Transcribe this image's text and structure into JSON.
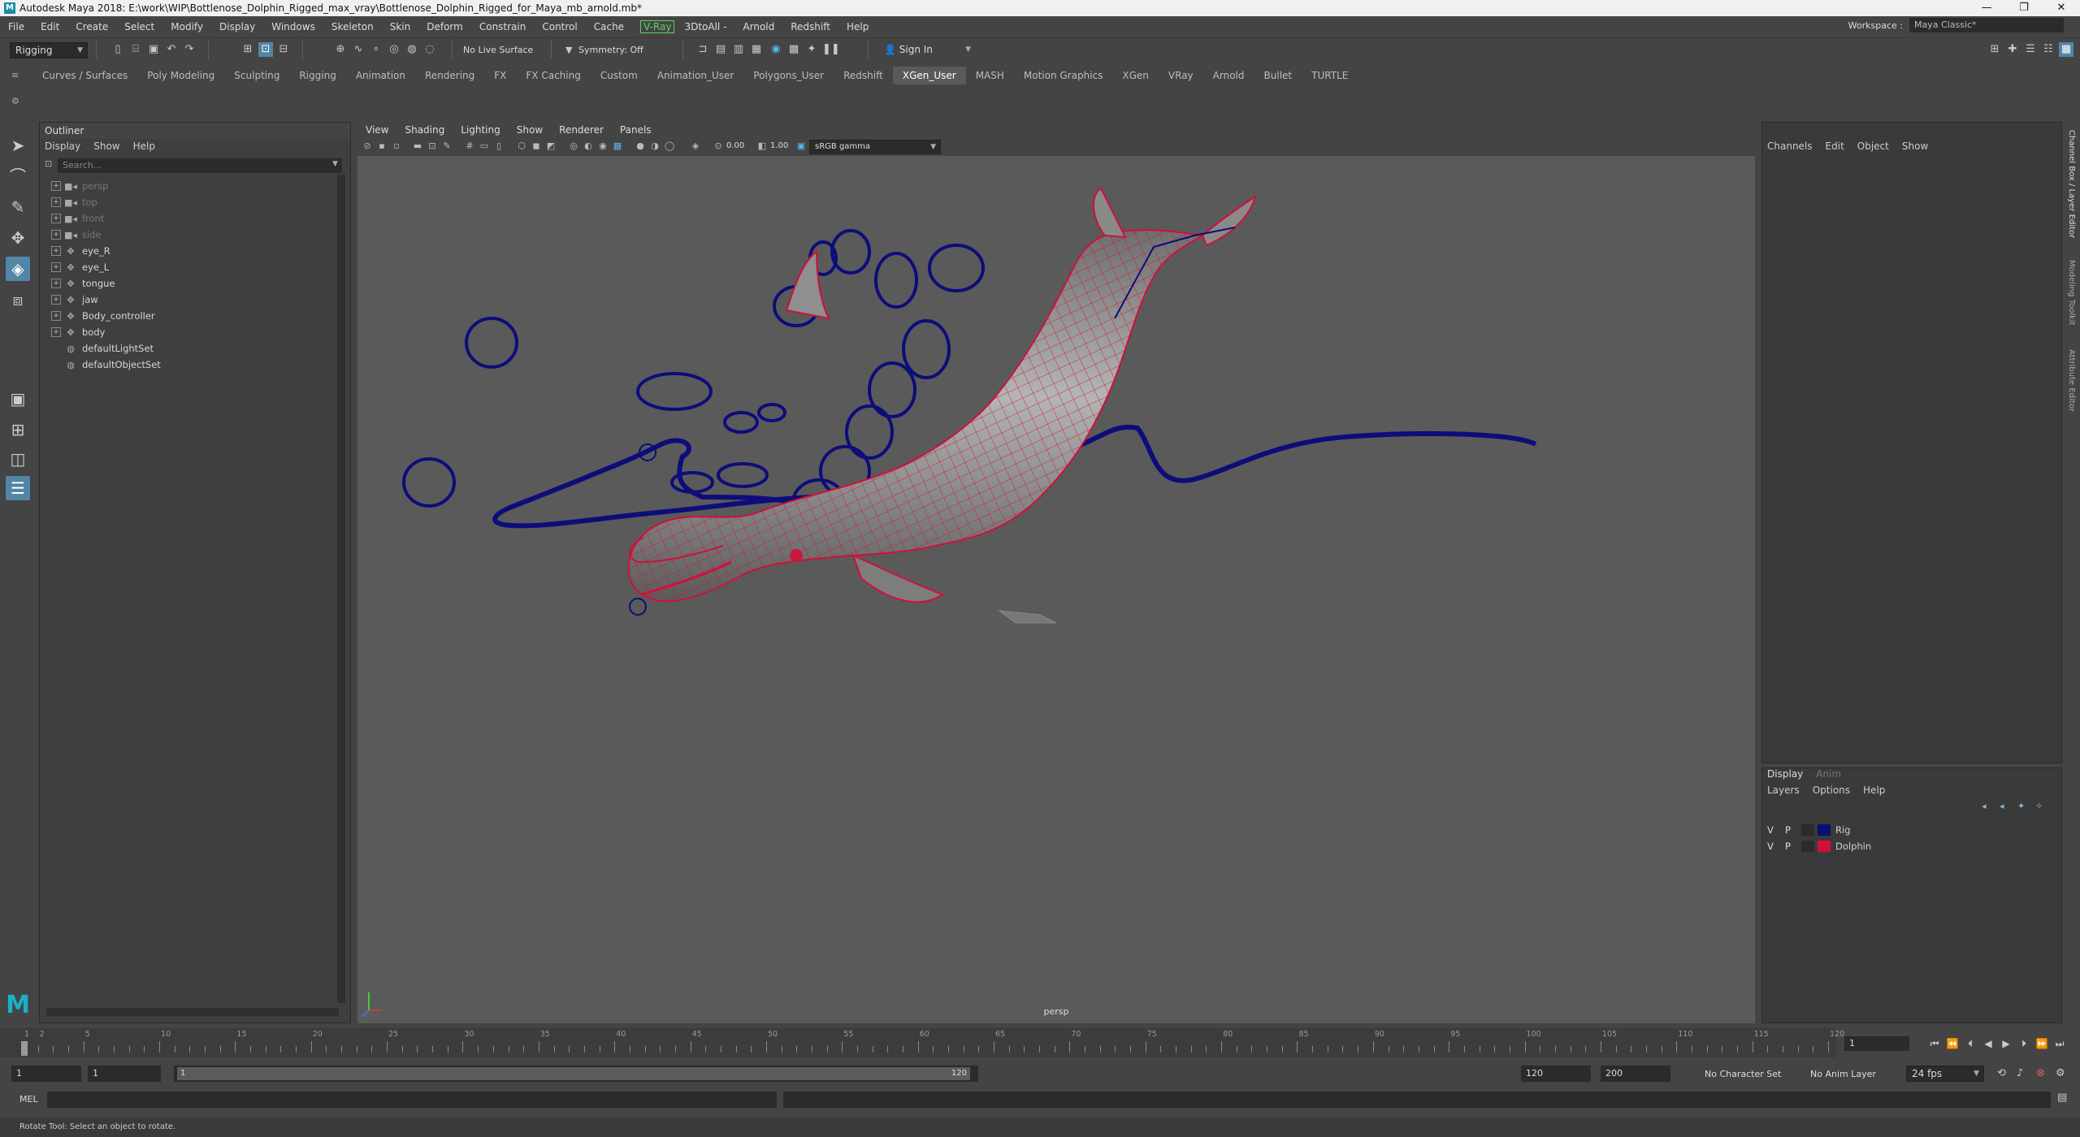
{
  "window": {
    "title": "Autodesk Maya 2018: E:\\work\\WIP\\Bottlenose_Dolphin_Rigged_max_vray\\Bottlenose_Dolphin_Rigged_for_Maya_mb_arnold.mb*",
    "app_icon": "M",
    "min": "—",
    "restore": "❐",
    "close": "✕"
  },
  "menubar": {
    "items": [
      "File",
      "Edit",
      "Create",
      "Select",
      "Modify",
      "Display",
      "Windows",
      "Skeleton",
      "Skin",
      "Deform",
      "Constrain",
      "Control",
      "Cache"
    ],
    "vray": "V-Ray",
    "items2": [
      "3DtoAll -",
      "Arnold",
      "Redshift",
      "Help"
    ],
    "workspace_label": "Workspace :",
    "workspace_value": "Maya Classic*"
  },
  "statusline": {
    "mode": "Rigging",
    "live_surface": "No Live Surface",
    "symmetry": "Symmetry: Off",
    "sign_in": "Sign In"
  },
  "shelf": {
    "tabs": [
      "Curves / Surfaces",
      "Poly Modeling",
      "Sculpting",
      "Rigging",
      "Animation",
      "Rendering",
      "FX",
      "FX Caching",
      "Custom",
      "Animation_User",
      "Polygons_User",
      "Redshift",
      "XGen_User",
      "MASH",
      "Motion Graphics",
      "XGen",
      "VRay",
      "Arnold",
      "Bullet",
      "TURTLE"
    ],
    "active": "XGen_User"
  },
  "outliner": {
    "title": "Outliner",
    "menu": [
      "Display",
      "Show",
      "Help"
    ],
    "search_placeholder": "Search...",
    "items": [
      {
        "name": "persp",
        "type": "camera",
        "dim": true
      },
      {
        "name": "top",
        "type": "camera",
        "dim": true
      },
      {
        "name": "front",
        "type": "camera",
        "dim": true
      },
      {
        "name": "side",
        "type": "camera",
        "dim": true
      },
      {
        "name": "eye_R",
        "type": "transform",
        "dim": false
      },
      {
        "name": "eye_L",
        "type": "transform",
        "dim": false
      },
      {
        "name": "tongue",
        "type": "transform",
        "dim": false
      },
      {
        "name": "jaw",
        "type": "transform",
        "dim": false
      },
      {
        "name": "Body_controller",
        "type": "transform",
        "dim": false
      },
      {
        "name": "body",
        "type": "transform",
        "dim": false
      },
      {
        "name": "defaultLightSet",
        "type": "set",
        "dim": false
      },
      {
        "name": "defaultObjectSet",
        "type": "set",
        "dim": false
      }
    ]
  },
  "viewport": {
    "menu": [
      "View",
      "Shading",
      "Lighting",
      "Show",
      "Renderer",
      "Panels"
    ],
    "exposure": "0.00",
    "gamma": "1.00",
    "color_space": "sRGB gamma",
    "camera": "persp"
  },
  "channelbox": {
    "menu": [
      "Channels",
      "Edit",
      "Object",
      "Show"
    ],
    "side_tabs": [
      "Channel Box / Layer Editor",
      "Modeling Toolkit",
      "Attribute Editor"
    ]
  },
  "layers": {
    "tabs": [
      "Display",
      "Anim"
    ],
    "menu": [
      "Layers",
      "Options",
      "Help"
    ],
    "rows": [
      {
        "v": "V",
        "p": "P",
        "name": "Rig",
        "color": "#0d0d7a"
      },
      {
        "v": "V",
        "p": "P",
        "name": "Dolphin",
        "color": "#d0103a"
      }
    ]
  },
  "timeline": {
    "ticks": [
      1,
      2,
      5,
      10,
      15,
      20,
      25,
      30,
      35,
      40,
      45,
      50,
      55,
      60,
      65,
      70,
      75,
      80,
      85,
      90,
      95,
      100,
      105,
      110,
      115,
      120
    ],
    "current_frame": "1"
  },
  "range": {
    "start": "1",
    "playback_start": "1",
    "slider_start": "1",
    "slider_end": "120",
    "playback_end": "120",
    "end": "200",
    "character_set": "No Character Set",
    "anim_layer": "No Anim Layer",
    "fps": "24 fps"
  },
  "cmdline": {
    "label": "MEL"
  },
  "helpline": {
    "text": "Rotate Tool: Select an object to rotate."
  },
  "colors": {
    "rig": "#0d0d7a",
    "mesh_wire": "#d0103a",
    "active_tool": "#5285a6"
  }
}
